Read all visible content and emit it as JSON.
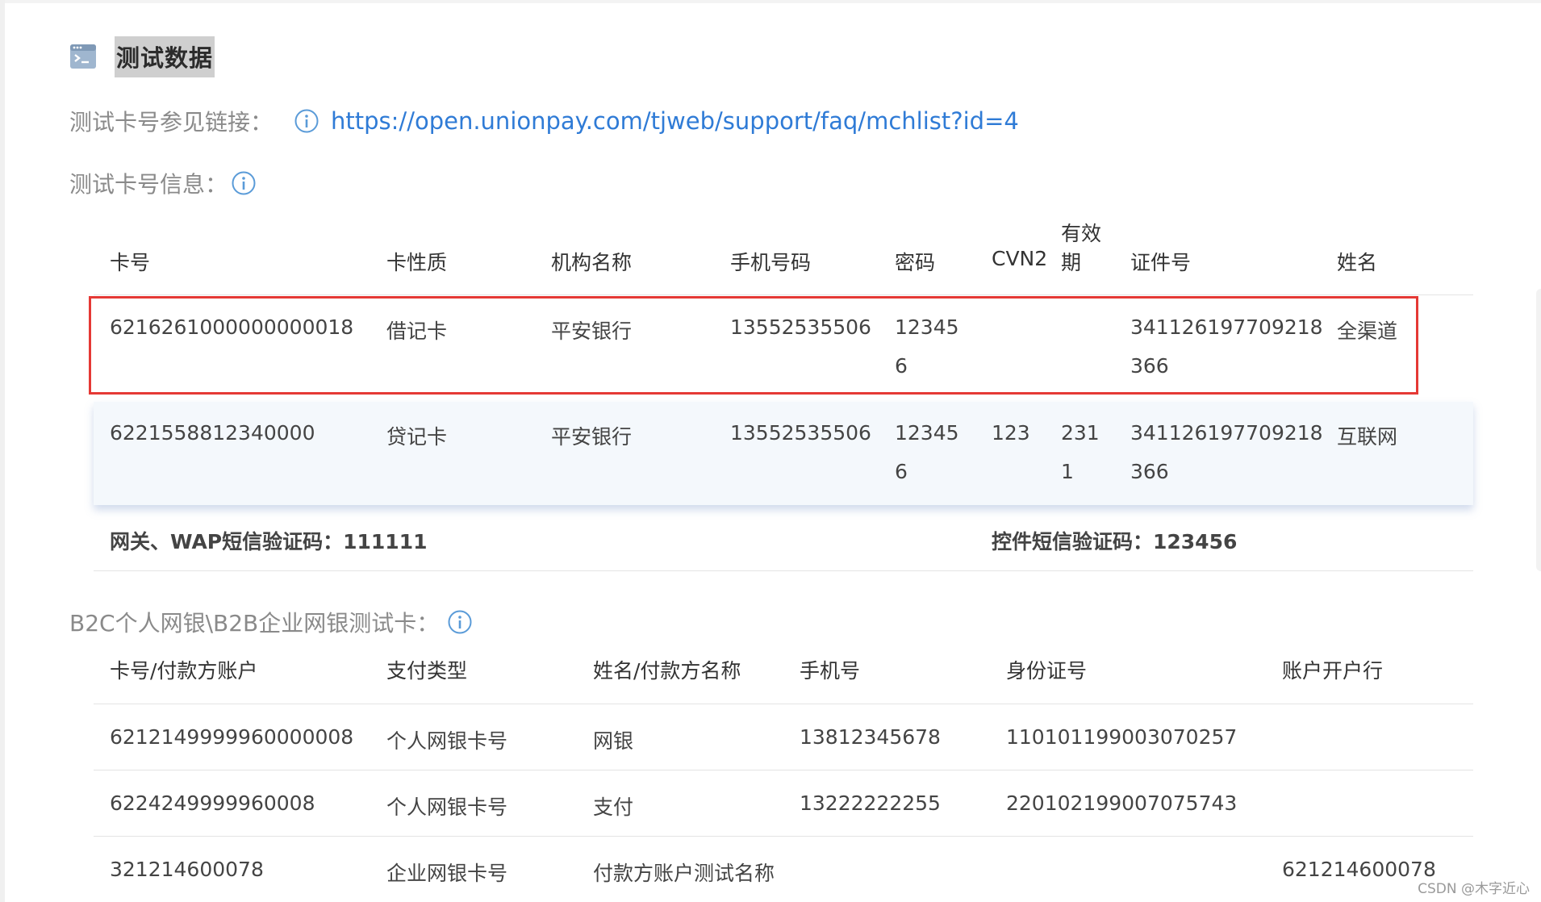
{
  "section_title": "测试数据",
  "test_link": {
    "label": "测试卡号参见链接：",
    "url": "https://open.unionpay.com/tjweb/support/faq/mchlist?id=4"
  },
  "card_info_label": "测试卡号信息：",
  "card_table": {
    "headers": {
      "card_no": "卡号",
      "card_type": "卡性质",
      "org": "机构名称",
      "phone": "手机号码",
      "pwd": "密码",
      "cvn2": "CVN2",
      "expiry_line1": "有效",
      "expiry_line2": "期",
      "id_no": "证件号",
      "name": "姓名"
    },
    "rows": [
      {
        "card_no": "6216261000000000018",
        "card_type": "借记卡",
        "org": "平安银行",
        "phone": "13552535506",
        "pwd_line1": "12345",
        "pwd_line2": "6",
        "cvn2": "",
        "expiry_line1": "",
        "expiry_line2": "",
        "id_line1": "341126197709218",
        "id_line2": "366",
        "name": "全渠道"
      },
      {
        "card_no": "6221558812340000",
        "card_type": "贷记卡",
        "org": "平安银行",
        "phone": "13552535506",
        "pwd_line1": "12345",
        "pwd_line2": "6",
        "cvn2": "123",
        "expiry_line1": "231",
        "expiry_line2": "1",
        "id_line1": "341126197709218",
        "id_line2": "366",
        "name": "互联网"
      }
    ]
  },
  "sms_notes": {
    "gateway": "网关、WAP短信验证码：111111",
    "widget": "控件短信验证码：123456"
  },
  "b2c_label": "B2C个人网银\\B2B企业网银测试卡：",
  "b2c_table": {
    "headers": {
      "card_no": "卡号/付款方账户",
      "pay_type": "支付类型",
      "name": "姓名/付款方名称",
      "phone": "手机号",
      "id_no": "身份证号",
      "bank": "账户开户行"
    },
    "rows": [
      {
        "card_no": "6212149999960000008",
        "pay_type": "个人网银卡号",
        "name": "网银",
        "phone": "13812345678",
        "id_no": "110101199003070257",
        "bank": ""
      },
      {
        "card_no": "6224249999960008",
        "pay_type": "个人网银卡号",
        "name": "支付",
        "phone": "13222222255",
        "id_no": "220102199007075743",
        "bank": ""
      },
      {
        "card_no": "321214600078",
        "pay_type": "企业网银卡号",
        "name": "付款方账户测试名称",
        "phone": "",
        "id_no": "",
        "bank": "621214600078"
      }
    ]
  },
  "watermark": "CSDN @木字近心",
  "colors": {
    "link": "#2f7bd6",
    "highlight_border": "#e53935",
    "hover_row_bg": "#f4f8fc",
    "icon_blue": "#5a9bd8"
  }
}
